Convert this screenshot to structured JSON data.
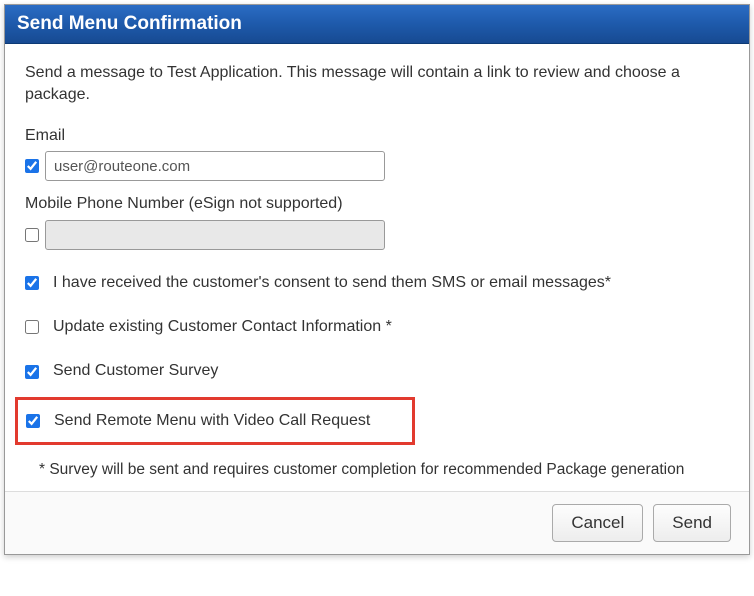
{
  "dialog": {
    "title": "Send Menu Confirmation",
    "intro": "Send a message to Test Application. This message will contain a link to review and choose a package."
  },
  "fields": {
    "email": {
      "label": "Email",
      "value": "user@routeone.com",
      "checked": true
    },
    "mobile": {
      "label": "Mobile Phone Number (eSign not supported)",
      "value": "",
      "checked": false
    }
  },
  "checks": {
    "consent": {
      "label": "I have received the customer's consent to send them SMS or email messages*",
      "checked": true
    },
    "update_contact": {
      "label": "Update existing Customer Contact Information *",
      "checked": false
    },
    "survey": {
      "label": "Send Customer Survey",
      "checked": true
    },
    "video_call": {
      "label": "Send Remote Menu with Video Call Request",
      "checked": true
    }
  },
  "footnote": "* Survey will be sent and requires customer completion for recommended Package generation",
  "buttons": {
    "cancel": "Cancel",
    "send": "Send"
  }
}
